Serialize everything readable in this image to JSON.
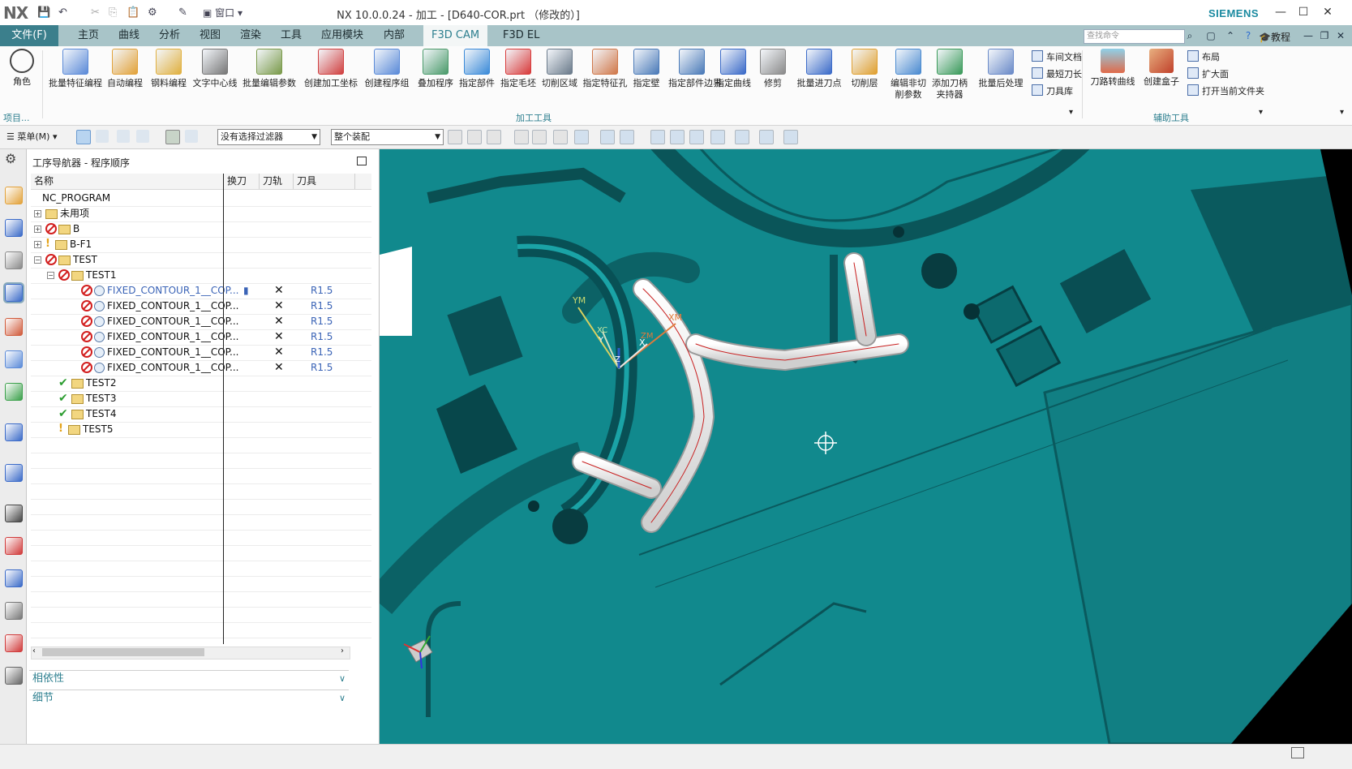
{
  "window": {
    "logo": "NX",
    "title": "NX 10.0.0.24 - 加工 - [D640-COR.prt （修改的）]",
    "brand": "SIEMENS",
    "window_menu_label": "窗口"
  },
  "menubar": {
    "items": [
      "文件(F)",
      "主页",
      "曲线",
      "分析",
      "视图",
      "渲染",
      "工具",
      "应用模块",
      "内部",
      "F3D CAM",
      "F3D EL"
    ],
    "active": "F3D CAM",
    "search_placeholder": "查找命令",
    "tutorial_label": "教程"
  },
  "ribbon": {
    "role_label": "角色",
    "project_label": "项目...",
    "big_buttons": [
      {
        "label": "批量特征编程",
        "icon": "batch-feature-program-icon"
      },
      {
        "label": "自动编程",
        "icon": "auto-program-icon"
      },
      {
        "label": "钢料编程",
        "icon": "steel-program-icon"
      },
      {
        "label": "文字中心线",
        "icon": "text-centerline-icon"
      },
      {
        "label": "批量编辑参数",
        "icon": "batch-edit-params-icon"
      },
      {
        "label": "创建加工坐标",
        "icon": "create-mcs-icon"
      },
      {
        "label": "创建程序组",
        "icon": "create-program-group-icon"
      },
      {
        "label": "叠加程序",
        "icon": "stack-program-icon"
      },
      {
        "label": "指定部件",
        "icon": "specify-part-icon"
      },
      {
        "label": "指定毛坯",
        "icon": "specify-blank-icon"
      },
      {
        "label": "切削区域",
        "icon": "cut-area-icon"
      },
      {
        "label": "指定特征孔",
        "icon": "specify-hole-icon"
      },
      {
        "label": "指定壁",
        "icon": "specify-wall-icon"
      },
      {
        "label": "指定部件边界",
        "icon": "part-boundary-icon"
      },
      {
        "label": "指定曲线",
        "icon": "specify-curve-icon"
      },
      {
        "label": "修剪",
        "icon": "trim-icon"
      },
      {
        "label": "批量进刀点",
        "icon": "batch-entry-point-icon"
      },
      {
        "label": "切削层",
        "icon": "cut-level-icon"
      },
      {
        "label": "编辑非切\n削参数",
        "icon": "non-cut-params-icon"
      },
      {
        "label": "添加刀柄\n夹持器",
        "icon": "add-holder-icon"
      },
      {
        "label": "批量后处理",
        "icon": "batch-postprocess-icon"
      }
    ],
    "small_buttons_1": [
      "车间文档",
      "最短刀长",
      "刀具库"
    ],
    "group1_label": "加工工具",
    "big_buttons_2": [
      {
        "label": "刀路转曲线",
        "icon": "toolpath-to-curve-icon"
      },
      {
        "label": "创建盒子",
        "icon": "create-box-icon"
      }
    ],
    "small_buttons_2": [
      "布局",
      "扩大面",
      "打开当前文件夹"
    ],
    "group2_label": "辅助工具"
  },
  "toolbar2": {
    "menu_label": "菜单(M)",
    "filter_value": "没有选择过滤器",
    "assembly_value": "整个装配"
  },
  "navigator": {
    "title": "工序导航器 - 程序顺序",
    "columns": [
      "名称",
      "换刀",
      "刀轨",
      "刀具"
    ],
    "rows": [
      {
        "name": "NC_PROGRAM",
        "indent": 0,
        "status": "",
        "toolchange": "",
        "path": "",
        "tool": ""
      },
      {
        "name": "未用项",
        "indent": 1,
        "status": "",
        "toolchange": "",
        "path": "",
        "tool": ""
      },
      {
        "name": "B",
        "indent": 1,
        "status": "no",
        "toolchange": "",
        "path": "",
        "tool": ""
      },
      {
        "name": "B-F1",
        "indent": 1,
        "status": "warn",
        "toolchange": "",
        "path": "",
        "tool": ""
      },
      {
        "name": "TEST",
        "indent": 1,
        "status": "no",
        "toolchange": "",
        "path": "",
        "tool": ""
      },
      {
        "name": "TEST1",
        "indent": 2,
        "status": "no",
        "toolchange": "",
        "path": "",
        "tool": ""
      },
      {
        "name": "FIXED_CONTOUR_1__COP...",
        "indent": 3,
        "status": "no",
        "toolchange": "▮",
        "path": "✕",
        "tool": "R1.5",
        "selected": true
      },
      {
        "name": "FIXED_CONTOUR_1__COP...",
        "indent": 3,
        "status": "no",
        "toolchange": "",
        "path": "✕",
        "tool": "R1.5"
      },
      {
        "name": "FIXED_CONTOUR_1__COP...",
        "indent": 3,
        "status": "no",
        "toolchange": "",
        "path": "✕",
        "tool": "R1.5"
      },
      {
        "name": "FIXED_CONTOUR_1__COP...",
        "indent": 3,
        "status": "no",
        "toolchange": "",
        "path": "✕",
        "tool": "R1.5"
      },
      {
        "name": "FIXED_CONTOUR_1__COP...",
        "indent": 3,
        "status": "no",
        "toolchange": "",
        "path": "✕",
        "tool": "R1.5"
      },
      {
        "name": "FIXED_CONTOUR_1__COP...",
        "indent": 3,
        "status": "no",
        "toolchange": "",
        "path": "✕",
        "tool": "R1.5"
      },
      {
        "name": "TEST2",
        "indent": 2,
        "status": "ok",
        "toolchange": "",
        "path": "",
        "tool": ""
      },
      {
        "name": "TEST3",
        "indent": 2,
        "status": "ok",
        "toolchange": "",
        "path": "",
        "tool": ""
      },
      {
        "name": "TEST4",
        "indent": 2,
        "status": "ok",
        "toolchange": "",
        "path": "",
        "tool": ""
      },
      {
        "name": "TEST5",
        "indent": 2,
        "status": "warn",
        "toolchange": "",
        "path": "",
        "tool": ""
      }
    ],
    "panels": [
      "相依性",
      "细节"
    ]
  },
  "viewport": {
    "background": "#11898d",
    "axis_labels": [
      "YM",
      "XC",
      "Y",
      "Z",
      "ZM",
      "X",
      "XM"
    ]
  },
  "colors": {
    "accent": "#2d7f8f",
    "menubar": "#a8c4c8",
    "file_menu": "#3b7f8c",
    "error": "#d21f1f",
    "ok": "#2c9d31"
  }
}
